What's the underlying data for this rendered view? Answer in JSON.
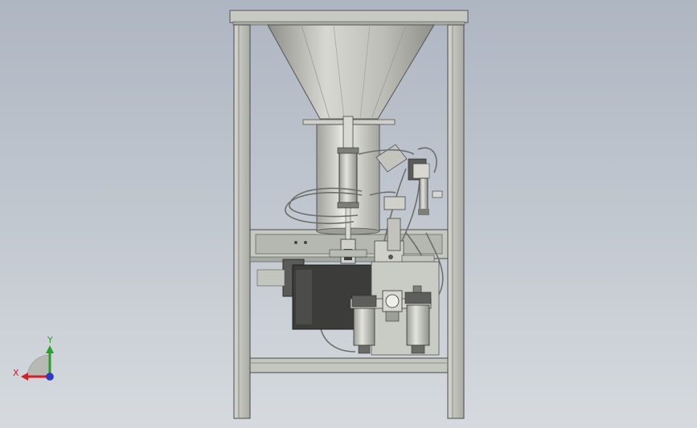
{
  "viewport": {
    "background_top": "#aeb6c2",
    "background_bottom": "#d6dade"
  },
  "model": {
    "frame_color": "#c9cbc6",
    "steel_color": "#b8bab3",
    "tube_color": "#9ea09a",
    "motor_color": "#3b3b39"
  },
  "triad": {
    "x_label": "X",
    "y_label": "Y",
    "x_color": "#d0202a",
    "y_color": "#2aa02a",
    "z_color": "#2a3ad0"
  }
}
